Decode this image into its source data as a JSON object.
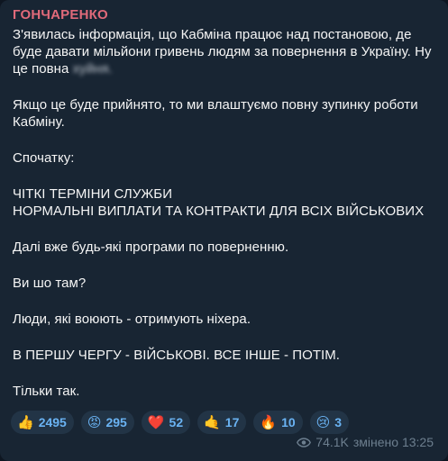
{
  "message": {
    "sender": "ГОНЧАРЕНКО",
    "lines": [
      "З'явилась інформація, що Кабміна працює над постановою, де буде давати мільйони гривень людям за повернення в Україну. Ну це повна ",
      "Якщо це буде прийнято, то ми влаштуємо повну зупинку роботи Кабміну.",
      "Спочатку:",
      "ЧІТКІ ТЕРМІНИ СЛУЖБИ",
      "НОРМАЛЬНІ ВИПЛАТИ ТА КОНТРАКТИ ДЛЯ ВСІХ ВІЙСЬКОВИХ",
      "Далі вже будь-які програми по поверненню.",
      "Ви шо там?",
      "Люди, які воюють - отримують ніхера.",
      "В ПЕРШУ ЧЕРГУ - ВІЙСЬКОВІ. ВСЕ ІНШЕ - ПОТІМ.",
      "Тільки так."
    ],
    "censored_word": "хуйня."
  },
  "reactions": [
    {
      "emoji": "👍",
      "count": "2495",
      "icon": "thumbs-up-icon"
    },
    {
      "emoji": "😡",
      "count": "295",
      "icon": "angry-face-icon"
    },
    {
      "emoji": "❤️",
      "count": "52",
      "icon": "heart-icon"
    },
    {
      "emoji": "🤙",
      "count": "17",
      "icon": "call-me-hand-icon"
    },
    {
      "emoji": "🔥",
      "count": "10",
      "icon": "fire-icon"
    },
    {
      "emoji": "😢",
      "count": "3",
      "icon": "crying-face-icon"
    }
  ],
  "meta": {
    "views": "74.1K",
    "edited": "змінено 13:25"
  },
  "colors": {
    "background": "#182533",
    "sender": "#e06a7a",
    "reaction_text": "#6ab3f3",
    "meta_text": "#6d7f8f"
  }
}
